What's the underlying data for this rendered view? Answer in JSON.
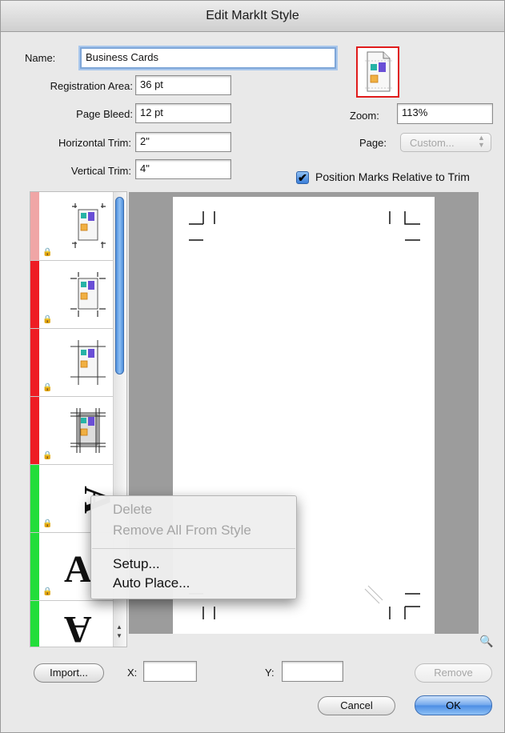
{
  "window": {
    "title": "Edit MarkIt Style"
  },
  "form": {
    "name_label": "Name:",
    "name_value": "Business Cards",
    "registration_label": "Registration Area:",
    "registration_value": "36 pt",
    "bleed_label": "Page Bleed:",
    "bleed_value": "12 pt",
    "htrim_label": "Horizontal Trim:",
    "htrim_value": "2\"",
    "vtrim_label": "Vertical Trim:",
    "vtrim_value": "4\""
  },
  "preview": {
    "zoom_label": "Zoom:",
    "zoom_value": "113%",
    "page_label": "Page:",
    "page_value": "Custom...",
    "position_marks_label": "Position Marks Relative to Trim",
    "position_marks_checked": true
  },
  "mark_list": {
    "items": [
      {
        "name": "crop-marks-light",
        "color": "#f0a6a6"
      },
      {
        "name": "crop-marks-1",
        "color": "#ee1c24"
      },
      {
        "name": "crop-marks-2",
        "color": "#ee1c24"
      },
      {
        "name": "crop-marks-3",
        "color": "#ee1c24"
      },
      {
        "name": "text-mark-1",
        "color": "#22dd3a",
        "glyph": "A"
      },
      {
        "name": "text-mark-2",
        "color": "#22dd3a",
        "glyph": "A"
      },
      {
        "name": "text-mark-3",
        "color": "#22dd3a",
        "glyph": "A"
      }
    ]
  },
  "context_menu": {
    "delete": "Delete",
    "remove_all": "Remove All From Style",
    "setup": "Setup...",
    "auto_place": "Auto Place..."
  },
  "bottom": {
    "import_label": "Import...",
    "x_label": "X:",
    "x_value": "",
    "y_label": "Y:",
    "y_value": "",
    "remove_label": "Remove",
    "cancel_label": "Cancel",
    "ok_label": "OK"
  },
  "colors": {
    "accent_blue": "#4b8de4",
    "lock_red": "#ee1c24",
    "text_green": "#22dd3a"
  }
}
